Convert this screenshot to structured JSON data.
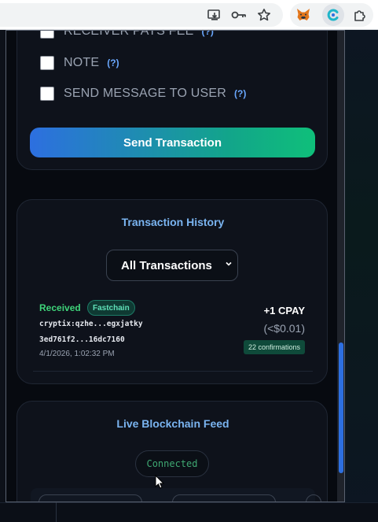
{
  "popup": {
    "options": [
      {
        "label": "RECEIVER PAYS FEE",
        "help": "(?)"
      },
      {
        "label": "NOTE",
        "help": "(?)"
      },
      {
        "label": "SEND MESSAGE TO USER",
        "help": "(?)"
      }
    ],
    "send_button_label": "Send Transaction",
    "history": {
      "title": "Transaction History",
      "filter_selected": "All Transactions",
      "transactions": [
        {
          "status": "Received",
          "badge": "Fastchain",
          "address": "cryptix:qzhe...egxjatky",
          "hash": "3ed761f2...16dc7160",
          "date": "4/1/2026, 1:02:32 PM",
          "amount": "+1 CPAY",
          "fiat": "(<$0.01)",
          "confirmations": "22 confirmations"
        }
      ]
    },
    "feed": {
      "title": "Live Blockchain Feed",
      "status": "Connected"
    }
  },
  "colors": {
    "accent_blue": "#2d6fe0",
    "accent_green": "#0fbf7a",
    "received_green": "#3fd47a",
    "title_blue": "#7ab4f0"
  }
}
